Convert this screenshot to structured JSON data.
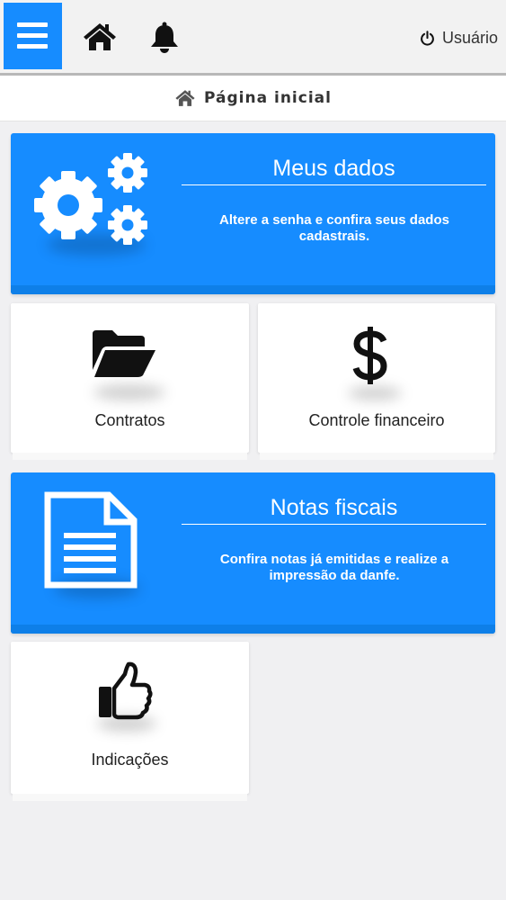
{
  "header": {
    "menu_icon": "hamburger-icon",
    "home_icon": "home-icon",
    "bell_icon": "bell-icon",
    "user_label": "Usuário",
    "user_icon": "power-icon"
  },
  "breadcrumb": {
    "icon": "home-icon",
    "title": "Página inicial"
  },
  "cards": {
    "meus_dados": {
      "title": "Meus dados",
      "description": "Altere a senha e confira seus dados cadastrais.",
      "icon": "gears-icon"
    },
    "contratos": {
      "label": "Contratos",
      "icon": "folder-open-icon"
    },
    "financeiro": {
      "label": "Controle financeiro",
      "icon": "dollar-icon"
    },
    "notas": {
      "title": "Notas fiscais",
      "description": "Confira notas já emitidas e realize a impressão da danfe.",
      "icon": "document-icon"
    },
    "indicacoes": {
      "label": "Indicações",
      "icon": "thumbs-up-icon"
    }
  },
  "colors": {
    "accent": "#168cff",
    "background": "#f0f0f2"
  }
}
